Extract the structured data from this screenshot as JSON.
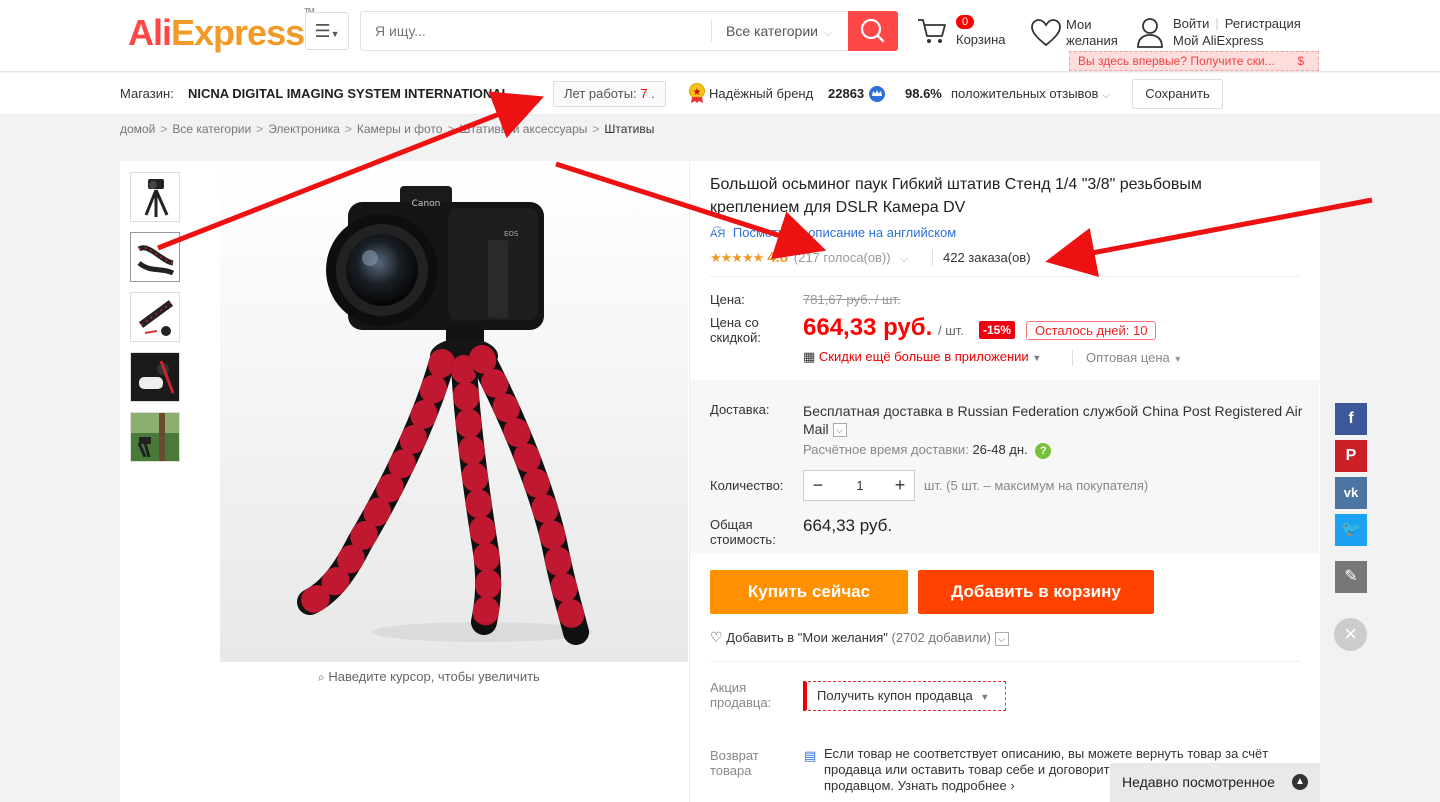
{
  "header": {
    "logo_part1": "Ali",
    "logo_part2": "Express",
    "logo_tm": "TM",
    "search_placeholder": "Я ищу...",
    "category_select": "Все категории",
    "cart_count": "0",
    "cart_label": "Корзина",
    "wishlist_label_1": "Мои",
    "wishlist_label_2": "желания",
    "login": "Войти",
    "register": "Регистрация",
    "my_aliexpress": "Мой AliExpress",
    "promo_text": "Вы здесь впервые? Получите ски...",
    "promo_currency": "$"
  },
  "store": {
    "label": "Магазин:",
    "name": "NICNA DIGITAL IMAGING SYSTEM INTERNATIONAL ...",
    "years_label": "Лет работы:",
    "years_value": "7",
    "years_dot": ".",
    "brand_label": "Надёжный бренд",
    "feedback_count": "22863",
    "positive_percent": "98.6%",
    "positive_label": "положительных отзывов",
    "save_button": "Сохранить"
  },
  "breadcrumbs": [
    "домой",
    "Все категории",
    "Электроника",
    "Камеры и фото",
    "Штативы и аксессуары",
    "Штативы"
  ],
  "product": {
    "title": "Большой осьминог паук Гибкий штатив Стенд 1/4 \"3/8\" резьбовым креплением для DSLR Камера DV",
    "translate_link": "Посмотреть описание на английском",
    "rating_score": "4.8",
    "votes": "(217 голоса(ов))",
    "orders": "422 заказа(ов)",
    "zoom_hint": "Наведите курсор, чтобы увеличить"
  },
  "price": {
    "price_label": "Цена:",
    "old_price": "781,67 руб. / шт.",
    "discount_label_1": "Цена со",
    "discount_label_2": "скидкой:",
    "new_price": "664,33 руб.",
    "per_unit": "/ шт.",
    "discount": "-15%",
    "days_left": "Осталось дней: 10",
    "app_discount": "Скидки ещё больше в приложении",
    "wholesale": "Оптовая цена"
  },
  "shipping": {
    "label": "Доставка:",
    "text": "Бесплатная доставка в Russian Federation службой China Post Registered Air Mail",
    "time_label": "Расчётное время доставки:",
    "time_value": "26-48 дн."
  },
  "quantity": {
    "label": "Количество:",
    "value": "1",
    "note": "шт. (5 шт. – максимум на покупателя)"
  },
  "total": {
    "label_1": "Общая",
    "label_2": "стоимость:",
    "value": "664,33 руб."
  },
  "actions": {
    "buy_now": "Купить сейчас",
    "add_to_cart": "Добавить в корзину",
    "wishlist_add": "Добавить в \"Мои желания\"",
    "wishlist_count": "(2702 добавили)"
  },
  "seller_promo": {
    "label_1": "Акция",
    "label_2": "продавца:",
    "coupon": "Получить купон продавца"
  },
  "returns": {
    "label_1": "Возврат",
    "label_2": "товара",
    "text": "Если товар не соответствует описанию, вы можете вернуть товар за счёт продавца или оставить товар себе и договориться о возврате средств с продавцом.",
    "more": "Узнать подробнее"
  },
  "recently_viewed": "Недавно посмотренное",
  "colors": {
    "brand_red": "#ff4747",
    "brand_orange": "#f29a27",
    "buy_button": "#ff9000",
    "cart_button": "#ff4200",
    "annotation_arrow": "#ee1111"
  }
}
